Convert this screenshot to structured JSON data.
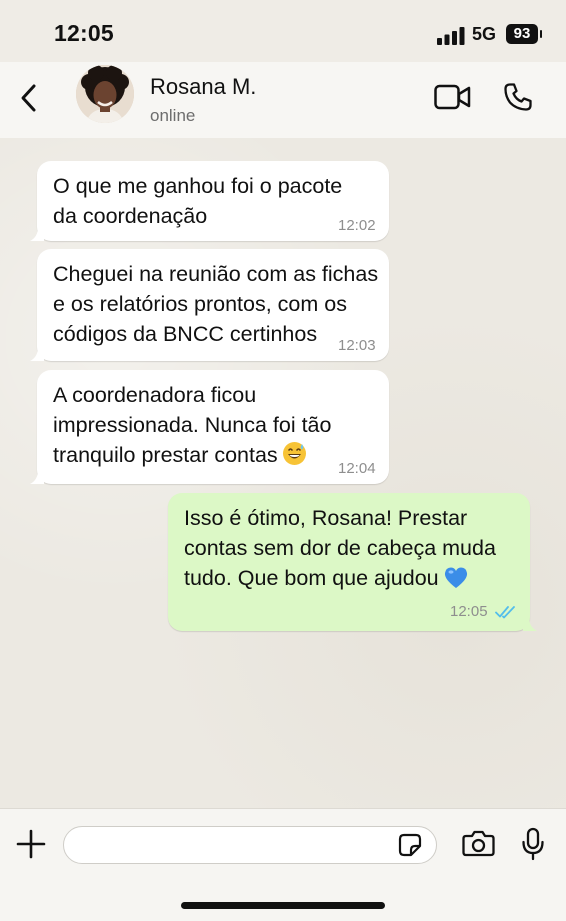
{
  "status_bar": {
    "time": "12:05",
    "network": "5G",
    "battery": "93"
  },
  "header": {
    "contact_name": "Rosana M.",
    "presence": "online"
  },
  "messages": [
    {
      "direction": "in",
      "text": "O que me ganhou foi o pacote\nda coordenação",
      "time": "12:02"
    },
    {
      "direction": "in",
      "text": "Cheguei na reunião com as fichas\ne os relatórios prontos, com os\ncódigos da BNCC certinhos",
      "time": "12:03"
    },
    {
      "direction": "in",
      "text": "A coordenadora ficou\nimpressionada. Nunca foi tão\ntranquilo prestar contas",
      "emoji": "grinning-sweat-emoji",
      "time": "12:04"
    },
    {
      "direction": "out",
      "text": "Isso é ótimo, Rosana! Prestar\ncontas sem dor de cabeça muda\ntudo. Que bom que ajudou",
      "emoji": "blue-heart-emoji",
      "time": "12:05",
      "receipt": "read-double-check-icon"
    }
  ],
  "composer": {
    "placeholder": "",
    "value": ""
  },
  "colors": {
    "incoming_bubble": "#ffffff",
    "outgoing_bubble": "#dcf8c6",
    "read_receipt": "#53bdeb",
    "chat_background": "#ece9e2"
  }
}
